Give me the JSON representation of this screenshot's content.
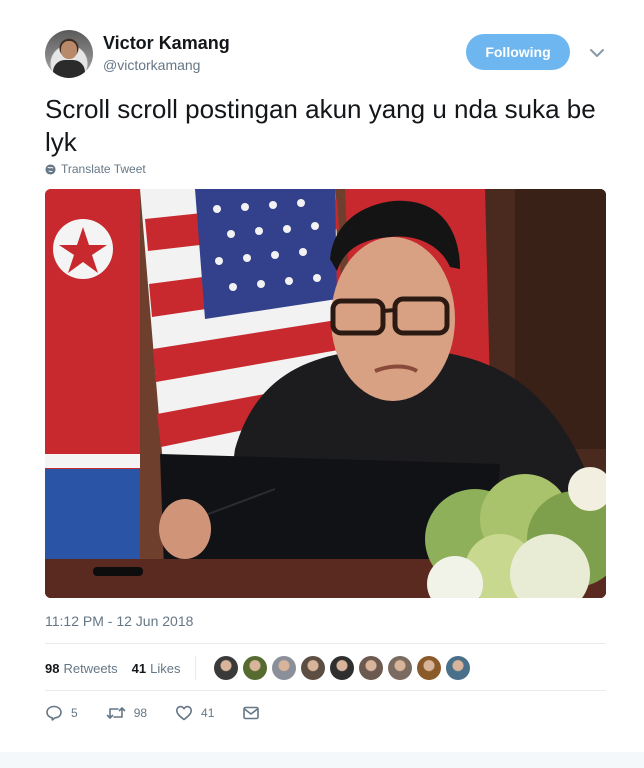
{
  "tweet": {
    "author": {
      "name": "Victor Kamang",
      "handle": "@victorkamang",
      "avatar_icon": "profile-photo"
    },
    "follow_label": "Following",
    "text": "Scroll scroll postingan akun yang u nda suka be lyk",
    "translate_label": "Translate Tweet",
    "timestamp": "11:12 PM - 12 Jun 2018",
    "retweets": {
      "count": "98",
      "label": "Retweets"
    },
    "likes": {
      "count": "41",
      "label": "Likes"
    },
    "likers": [
      {
        "color": "#3a3a3a"
      },
      {
        "color": "#556b2f"
      },
      {
        "color": "#8a8f99"
      },
      {
        "color": "#5d4e44"
      },
      {
        "color": "#2f2f2f"
      },
      {
        "color": "#6c5a50"
      },
      {
        "color": "#7a6a5f"
      },
      {
        "color": "#8b5a2b"
      },
      {
        "color": "#4a6f8a"
      }
    ],
    "actions": {
      "reply": "5",
      "retweet": "98",
      "like": "41"
    },
    "colors": {
      "accent": "#6db6ef",
      "muted": "#657786"
    }
  }
}
